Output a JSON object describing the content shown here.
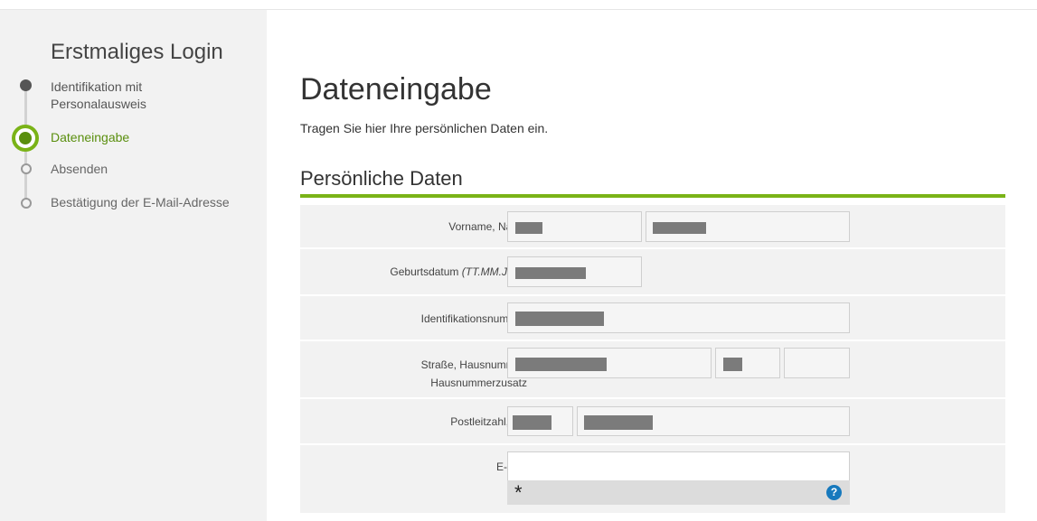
{
  "sidebar": {
    "title": "Erstmaliges Login",
    "steps": [
      {
        "label_line1": "Identifikation mit",
        "label_line2": "Personalausweis",
        "state": "done"
      },
      {
        "label": "Dateneingabe",
        "state": "active"
      },
      {
        "label": "Absenden",
        "state": "open"
      },
      {
        "label": "Bestätigung der E-Mail-Adresse",
        "state": "open"
      }
    ]
  },
  "main": {
    "title": "Dateneingabe",
    "intro": "Tragen Sie hier Ihre persönlichen Daten ein.",
    "section_title": "Persönliche Daten",
    "fields": {
      "name_label": "Vorname,  Name",
      "birth_label": "Geburtsdatum",
      "birth_hint": "(TT.MM.JJJJ)",
      "id_label": "Identifikationsnummer",
      "street_label_line1": "Straße,  Hausnummer,",
      "street_label_line2": "Hausnummerzusatz",
      "postal_label": "Postleitzahl,  Ort",
      "email_label": "E-Mail"
    },
    "email_value": "",
    "required_marker": "*",
    "help_icon_text": "?"
  },
  "colors": {
    "accent": "#7ab317",
    "accent_dark": "#5a8f0e",
    "help_blue": "#1779bd"
  }
}
